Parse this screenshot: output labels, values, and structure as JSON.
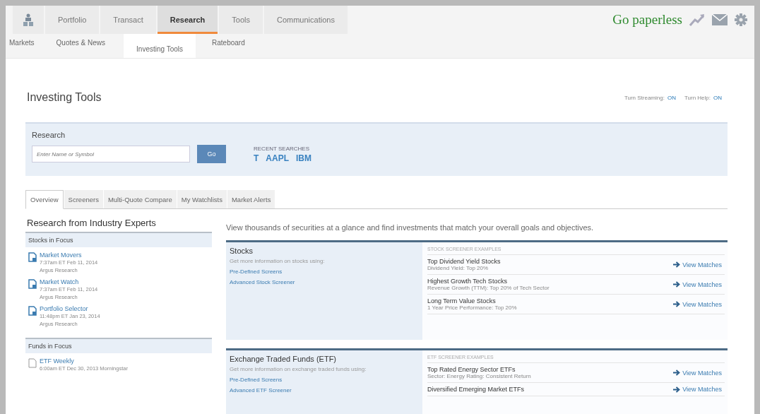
{
  "main_nav": {
    "tabs": [
      {
        "label": "Portfolio",
        "selected": false
      },
      {
        "label": "Transact",
        "selected": false
      },
      {
        "label": "Research",
        "selected": true
      },
      {
        "label": "Tools",
        "selected": false
      },
      {
        "label": "Communications",
        "selected": false
      }
    ],
    "promo": "Go paperless"
  },
  "sub_nav": {
    "tabs": [
      {
        "label": "Markets",
        "selected": false
      },
      {
        "label": "Quotes & News",
        "selected": false
      },
      {
        "label": "Investing Tools",
        "selected": true
      },
      {
        "label": "Rateboard",
        "selected": false
      }
    ]
  },
  "page": {
    "title": "Investing Tools",
    "toggles": [
      {
        "label": "Turn Streaming:",
        "value": "ON"
      },
      {
        "label": "Turn Help:",
        "value": "ON"
      }
    ]
  },
  "research": {
    "title": "Research",
    "search": {
      "placeholder": "Enter Name or Symbol"
    },
    "button": "Go",
    "recent_label": "RECENT SEARCHES",
    "recent": [
      "T",
      "AAPL",
      "IBM"
    ]
  },
  "tabs": [
    {
      "label": "Overview",
      "selected": true
    },
    {
      "label": "Screeners",
      "selected": false
    },
    {
      "label": "Multi-Quote Compare",
      "selected": false
    },
    {
      "label": "My Watchlists",
      "selected": false
    },
    {
      "label": "Market Alerts",
      "selected": false
    }
  ],
  "sidebar": {
    "title": "Research from Industry Experts",
    "sections": [
      {
        "title": "Stocks in Focus",
        "items": [
          {
            "title": "Market Movers",
            "date": "7:37am ET Feb 11, 2014",
            "source": "Argus Research",
            "kind": "report"
          },
          {
            "title": "Market Watch",
            "date": "7:37am ET Feb 11, 2014",
            "source": "Argus Research",
            "kind": "report"
          },
          {
            "title": "Portfolio Selector",
            "date": "11:48pm ET Jan 23, 2014",
            "source": "Argus Research",
            "kind": "report"
          }
        ]
      },
      {
        "title": "Funds in Focus",
        "items": [
          {
            "title": "ETF Weekly",
            "date": "6:00am ET Dec 30, 2013 Morningstar",
            "kind": "document"
          }
        ]
      }
    ]
  },
  "overview": {
    "intro": "View thousands of securities at a glance and find investments that match your overall goals and objectives.",
    "sections": [
      {
        "title": "Stocks",
        "text": "Get more information on stocks using:",
        "links": [
          "Pre-Defined Screens",
          "Advanced Stock Screener"
        ],
        "examples_title": "STOCK SCREENER EXAMPLES",
        "examples": [
          {
            "name": "Top Dividend Yield Stocks",
            "criteria": "Dividend Yield: Top 20%",
            "action": "View Matches"
          },
          {
            "name": "Highest Growth Tech Stocks",
            "criteria": "Revenue Growth (TTM): Top 20% of Tech Sector",
            "action": "View Matches"
          },
          {
            "name": "Long Term Value Stocks",
            "criteria": "1 Year Price Performance: Top 20%",
            "action": "View Matches"
          }
        ]
      },
      {
        "title": "Exchange Traded Funds (ETF)",
        "text": "Get more information on exchange traded funds using:",
        "links": [
          "Pre-Defined Screens",
          "Advanced ETF Screener"
        ],
        "examples_title": "ETF SCREENER EXAMPLES",
        "examples": [
          {
            "name": "Top Rated Energy Sector ETFs",
            "criteria": "Sector: Energy Rating: Consistent Return",
            "action": "View Matches"
          },
          {
            "name": "Diversified Emerging Market ETFs",
            "action": "View Matches"
          }
        ]
      }
    ]
  }
}
